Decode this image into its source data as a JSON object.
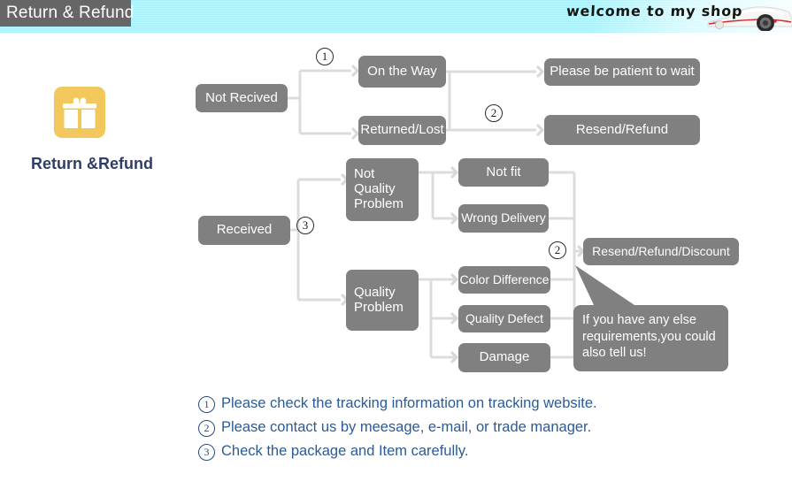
{
  "banner": {
    "title": "Return & Refund",
    "welcome": "welcome to my shop",
    "car_icon": "sports-car-image"
  },
  "left_panel": {
    "icon": "gift-box-icon",
    "label": "Return &Refund"
  },
  "flow": {
    "nodes": [
      {
        "id": "not_received",
        "label": "Not Recived"
      },
      {
        "id": "on_the_way",
        "label": "On the Way"
      },
      {
        "id": "returned_lost",
        "label": "Returned/Lost"
      },
      {
        "id": "please_wait",
        "label": "Please be patient to wait"
      },
      {
        "id": "resend_refund",
        "label": "Resend/Refund"
      },
      {
        "id": "received",
        "label": "Received"
      },
      {
        "id": "not_quality_problem",
        "label": "Not Quality Problem"
      },
      {
        "id": "quality_problem",
        "label": "Quality Problem"
      },
      {
        "id": "not_fit",
        "label": "Not fit"
      },
      {
        "id": "wrong_delivery",
        "label": "Wrong Delivery"
      },
      {
        "id": "color_difference",
        "label": "Color Difference"
      },
      {
        "id": "quality_defect",
        "label": "Quality Defect"
      },
      {
        "id": "damage",
        "label": "Damage"
      },
      {
        "id": "resend_refund_discount",
        "label": "Resend/Refund/Discount"
      }
    ],
    "markers": [
      {
        "id": "marker_1_top",
        "label": "1"
      },
      {
        "id": "marker_2_top",
        "label": "2"
      },
      {
        "id": "marker_3_middle",
        "label": "3"
      },
      {
        "id": "marker_2_right",
        "label": "2"
      }
    ],
    "bubble": {
      "line1": "If you have any else",
      "line2": "requirements,you could",
      "line3": "also tell us!"
    }
  },
  "legend": [
    {
      "num": "1",
      "text": "Please check the tracking information on tracking website."
    },
    {
      "num": "2",
      "text": "Please contact us by meesage, e-mail, or trade manager."
    },
    {
      "num": "3",
      "text": "Check the package and Item carefully."
    }
  ],
  "colors": {
    "node_gray": "#808080",
    "connector": "#d9d9d9",
    "header_gray": "#666666",
    "banner_cyan": "#a8effb",
    "gift_gold": "#f2c75c",
    "legend_blue": "#2b5b96",
    "gift_label_blue": "#2e3e66"
  }
}
